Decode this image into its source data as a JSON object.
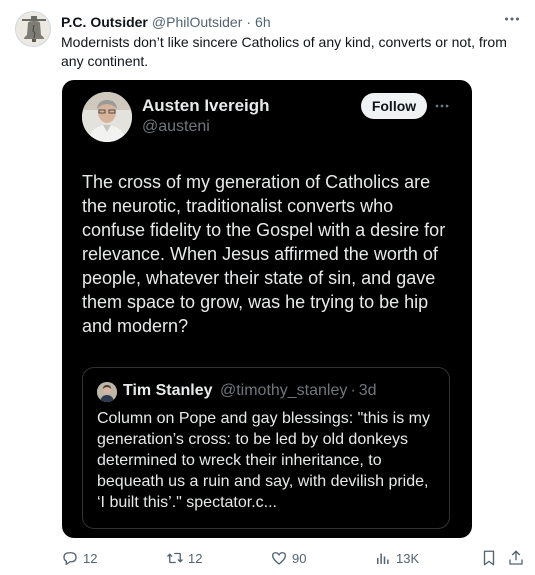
{
  "tweet": {
    "author_name": "P.C. Outsider",
    "author_handle": "@PhilOutsider",
    "separator": "·",
    "time": "6h",
    "text": "Modernists don’t like sincere Catholics of any kind, converts or not, from any continent."
  },
  "screenshot": {
    "author_name": "Austen Ivereigh",
    "author_handle": "@austeni",
    "follow_label": "Follow",
    "text": "The cross of my generation of Catholics are the neurotic, traditionalist converts who confuse fidelity to the Gospel with a desire for relevance. When Jesus affirmed the worth of people, whatever their state of sin, and gave them space to grow, was he trying to be hip and modern?",
    "quote": {
      "author_name": "Tim Stanley",
      "author_handle": "@timothy_stanley",
      "separator": "·",
      "time": "3d",
      "text": "Column on Pope and gay blessings: \"this is my generation’s cross: to be led by old donkeys determined to wreck their inheritance, to bequeath us a ruin and say, with devilish pride, ‘I built this’.\" spectator.c..."
    }
  },
  "actions": {
    "replies": "12",
    "reposts": "12",
    "likes": "90",
    "views": "13K"
  },
  "colors": {
    "text": "#0f1419",
    "secondary": "#536471",
    "dark_bg": "#000000",
    "dark_text": "#e7e9ea",
    "dark_secondary": "#71767b"
  }
}
